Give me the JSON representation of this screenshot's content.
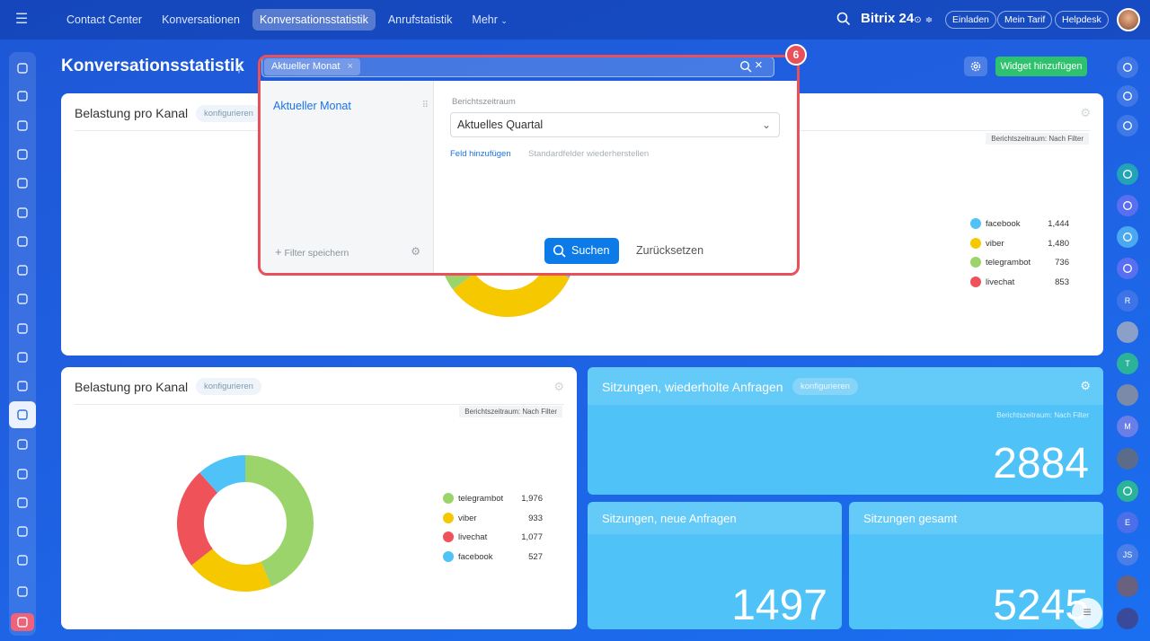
{
  "topbar": {
    "nav": [
      "Contact Center",
      "Konversationen",
      "Konversationsstatistik",
      "Anrufstatistik",
      "Mehr"
    ],
    "brand": "Bitrix 24",
    "invite": "Einladen",
    "plan": "Mein Tarif",
    "help": "Helpdesk"
  },
  "page": {
    "title": "Konversationsstatistik",
    "add_widget": "Widget hinzufügen"
  },
  "filter": {
    "chip": "Aktueller Monat",
    "preset": "Aktueller Monat",
    "field_label": "Berichtszeitraum",
    "field_value": "Aktuelles Quartal",
    "add_field": "Feld hinzufügen",
    "restore": "Standardfelder wiederherstellen",
    "save": "Filter speichern",
    "search": "Suchen",
    "reset": "Zurücksetzen",
    "step": "6"
  },
  "card_top": {
    "title": "Belastung pro Kanal",
    "configure": "konfigurieren",
    "period": "Berichtszeitraum: Nach Filter",
    "legend": [
      {
        "name": "facebook",
        "value": "1,444"
      },
      {
        "name": "viber",
        "value": "1,480"
      },
      {
        "name": "telegrambot",
        "value": "736"
      },
      {
        "name": "livechat",
        "value": "853"
      }
    ]
  },
  "card_bottom": {
    "title": "Belastung pro Kanal",
    "configure": "konfigurieren",
    "period": "Berichtszeitraum: Nach Filter",
    "legend": [
      {
        "name": "telegrambot",
        "value": "1,976"
      },
      {
        "name": "viber",
        "value": "933"
      },
      {
        "name": "livechat",
        "value": "1,077"
      },
      {
        "name": "facebook",
        "value": "527"
      }
    ]
  },
  "kpi": {
    "repeat_title": "Sitzungen, wiederholte Anfragen",
    "repeat_configure": "konfigurieren",
    "repeat_period": "Berichtszeitraum: Nach Filter",
    "repeat_value": "2884",
    "new_title": "Sitzungen, neue Anfragen",
    "new_value": "1497",
    "total_title": "Sitzungen gesamt",
    "total_value": "5245"
  },
  "right_avatars": [
    "R",
    "T",
    "M",
    "E",
    "JS"
  ],
  "colors": {
    "facebook": "#4fc3f7",
    "viber": "#f5c800",
    "telegrambot": "#9bd46b",
    "livechat": "#f0525a",
    "accent": "#0c7be8",
    "highlight": "#e8505b"
  },
  "chart_data": [
    {
      "type": "pie",
      "categories": [
        "facebook",
        "viber",
        "telegrambot",
        "livechat"
      ],
      "values": [
        1444,
        1480,
        736,
        853
      ]
    },
    {
      "type": "pie",
      "categories": [
        "telegrambot",
        "viber",
        "livechat",
        "facebook"
      ],
      "values": [
        1976,
        933,
        1077,
        527
      ]
    }
  ]
}
